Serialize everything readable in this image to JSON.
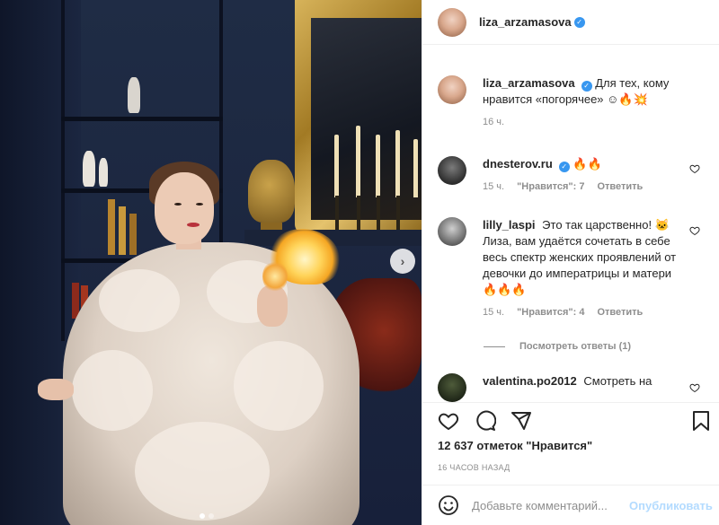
{
  "post": {
    "author": "liza_arzamasova",
    "image_alt": "photo",
    "carousel_dots": 2
  },
  "caption": {
    "username": "liza_arzamasova",
    "text": "Для тех, кому нравится «погорячее» ☺🔥💥",
    "time": "16 ч."
  },
  "comments": [
    {
      "username": "dnesterov.ru",
      "text": "🔥🔥",
      "time": "15 ч.",
      "likes": "\"Нравится\": 7",
      "reply": "Ответить",
      "verified": true
    },
    {
      "username": "lilly_laspi",
      "text": "Это так царственно! 🐱 Лиза, вам удаётся сочетать в себе весь спектр женских проявлений от девочки до императрицы и матери 🔥🔥🔥",
      "time": "15 ч.",
      "likes": "\"Нравится\": 4",
      "reply": "Ответить",
      "verified": false
    },
    {
      "username": "valentina.po2012",
      "text": "Смотреть на",
      "verified": false
    }
  ],
  "view_replies": "Посмотреть ответы (1)",
  "likes_text": "12 637 отметок \"Нравится\"",
  "posted_ago": "16 ЧАСОВ НАЗАД",
  "add_comment": {
    "placeholder": "Добавьте комментарий...",
    "publish_label": "Опубликовать"
  },
  "colors": {
    "verified": "#3897f0",
    "publish_disabled": "#b3dbff",
    "secondary_text": "#8e8e8e"
  }
}
